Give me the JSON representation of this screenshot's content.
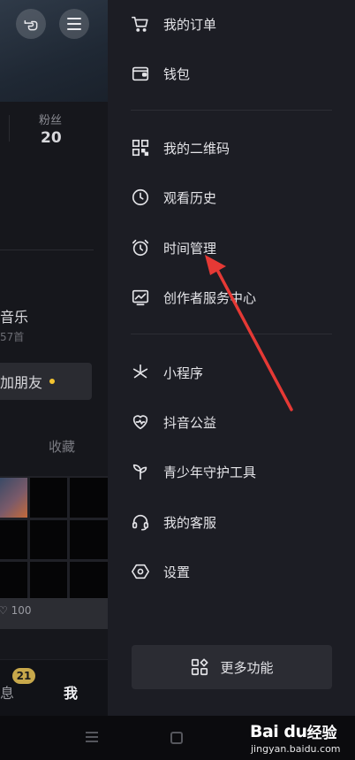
{
  "profile": {
    "fans_label": "粉丝",
    "fans_value": "20",
    "music_title": "音乐",
    "music_sub": "57首",
    "add_friend_label": "加朋友",
    "fav_tab_label": "收藏",
    "likes_text": "100",
    "bottom_tabs": {
      "message_label": "息",
      "message_badge": "21",
      "me_label": "我"
    }
  },
  "drawer": {
    "items": [
      {
        "label": "我的订单",
        "icon": "cart-icon"
      },
      {
        "label": "钱包",
        "icon": "wallet-icon"
      },
      {
        "label": "我的二维码",
        "icon": "qrcode-icon"
      },
      {
        "label": "观看历史",
        "icon": "clock-icon"
      },
      {
        "label": "时间管理",
        "icon": "alarm-clock-icon"
      },
      {
        "label": "创作者服务中心",
        "icon": "chart-monitor-icon"
      },
      {
        "label": "小程序",
        "icon": "asterisk-icon"
      },
      {
        "label": "抖音公益",
        "icon": "heart-pulse-icon"
      },
      {
        "label": "青少年守护工具",
        "icon": "sprout-icon"
      },
      {
        "label": "我的客服",
        "icon": "headset-icon"
      },
      {
        "label": "设置",
        "icon": "hexagon-gear-icon"
      }
    ],
    "more_label": "更多功能"
  },
  "watermark": {
    "logo_text": "Bai du",
    "sub_text": "经验",
    "url": "jingyan.baidu.com"
  },
  "colors": {
    "drawer_bg": "#1c1d24",
    "arrow": "#e53935",
    "badge": "#c8a84b"
  }
}
